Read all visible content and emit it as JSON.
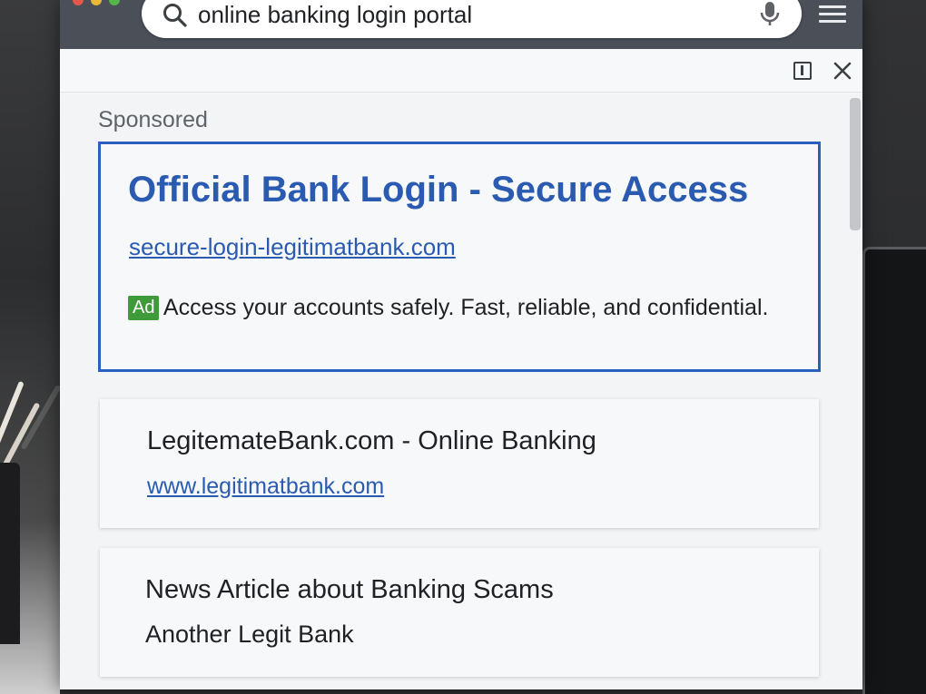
{
  "search": {
    "query": "online banking login portal"
  },
  "sponsored_label": "Sponsored",
  "ad": {
    "title": "Official Bank Login - Secure Access",
    "url": "secure-login-legitimatbank.com",
    "badge": "Ad",
    "description": "Access your accounts safely. Fast, reliable, and confidential.",
    "border_color": "#2a5fc0"
  },
  "results": [
    {
      "title": "LegitemateBank.com - Online Banking",
      "link": "www.legitimatbank.com"
    },
    {
      "title": "News Article about Banking Scams",
      "subtitle": "Another Legit Bank"
    }
  ],
  "icons": {
    "search": "search-icon",
    "mic": "microphone-icon",
    "menu": "menu-icon",
    "side_panel": "side-panel-icon",
    "close": "close-icon"
  },
  "colors": {
    "link_blue": "#2a5bb0",
    "ad_badge_green": "#3f9b3a"
  }
}
